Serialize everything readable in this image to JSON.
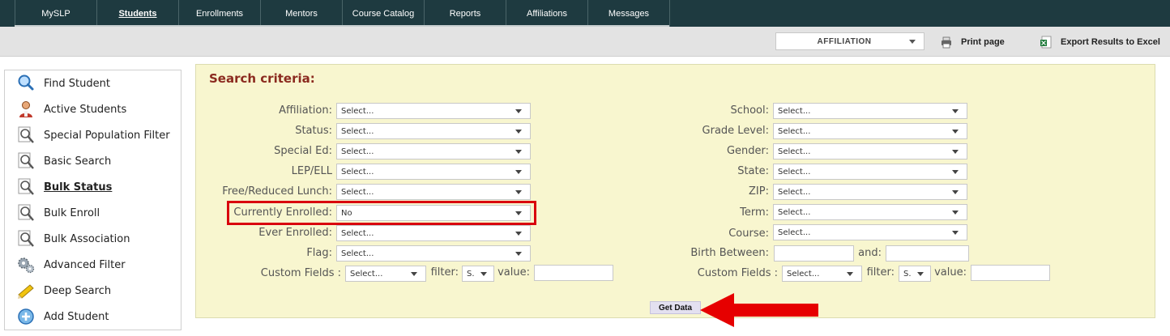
{
  "nav": {
    "items": [
      {
        "label": "MySLP",
        "width": 101
      },
      {
        "label": "Students",
        "width": 101,
        "active": true
      },
      {
        "label": "Enrollments",
        "width": 101
      },
      {
        "label": "Mentors",
        "width": 101
      },
      {
        "label": "Course Catalog",
        "width": 101
      },
      {
        "label": "Reports",
        "width": 101
      },
      {
        "label": "Affiliations",
        "width": 101
      },
      {
        "label": "Messages",
        "width": 101
      }
    ]
  },
  "toolbar": {
    "affiliation_select": "AFFILIATION",
    "print_label": "Print page",
    "export_label": "Export Results to Excel"
  },
  "sidebar": {
    "items": [
      {
        "label": "Find Student",
        "icon": "magnifier-icon"
      },
      {
        "label": "Active Students",
        "icon": "person-icon"
      },
      {
        "label": "Special Population Filter",
        "icon": "zoom-doc-icon"
      },
      {
        "label": "Basic Search",
        "icon": "zoom-doc-icon"
      },
      {
        "label": "Bulk Status",
        "icon": "zoom-doc-icon",
        "active": true
      },
      {
        "label": "Bulk Enroll",
        "icon": "zoom-doc-icon"
      },
      {
        "label": "Bulk Association",
        "icon": "zoom-doc-icon"
      },
      {
        "label": "Advanced Filter",
        "icon": "gears-icon"
      },
      {
        "label": "Deep Search",
        "icon": "pencil-icon"
      },
      {
        "label": "Add Student",
        "icon": "add-icon"
      }
    ]
  },
  "search": {
    "title": "Search criteria:",
    "left_fields": [
      {
        "label": "Affiliation:",
        "value": "Select..."
      },
      {
        "label": "Status:",
        "value": "Select..."
      },
      {
        "label": "Special Ed:",
        "value": "Select..."
      },
      {
        "label": "LEP/ELL",
        "value": "Select..."
      },
      {
        "label": "Free/Reduced Lunch:",
        "value": "Select..."
      },
      {
        "label": "Currently Enrolled:",
        "value": "No"
      },
      {
        "label": "Ever Enrolled:",
        "value": "Select..."
      },
      {
        "label": "Flag:",
        "value": "Select..."
      }
    ],
    "right_fields": [
      {
        "label": "School:",
        "value": "Select..."
      },
      {
        "label": "Grade Level:",
        "value": "Select..."
      },
      {
        "label": "Gender:",
        "value": "Select..."
      },
      {
        "label": "State:",
        "value": "Select..."
      },
      {
        "label": "ZIP:",
        "value": "Select..."
      },
      {
        "label": "Term:",
        "value": "Select..."
      },
      {
        "label": "Course:",
        "value": "Select..."
      }
    ],
    "birth_between_label": "Birth Between:",
    "and_label": "and:",
    "custom_left": {
      "label": "Custom Fields :",
      "select": "Select...",
      "filter_label": "filter:",
      "filter_value": "S.",
      "value_label": "value:"
    },
    "custom_right": {
      "label": "Custom Fields :",
      "select": "Select...",
      "filter_label": "filter:",
      "filter_value": "S.",
      "value_label": "value:"
    },
    "get_data_label": "Get Data"
  },
  "colors": {
    "nav_bg": "#1e3a40",
    "panel_bg": "#f8f6cf",
    "title": "#8b2a1f",
    "highlight": "#d9000d"
  }
}
